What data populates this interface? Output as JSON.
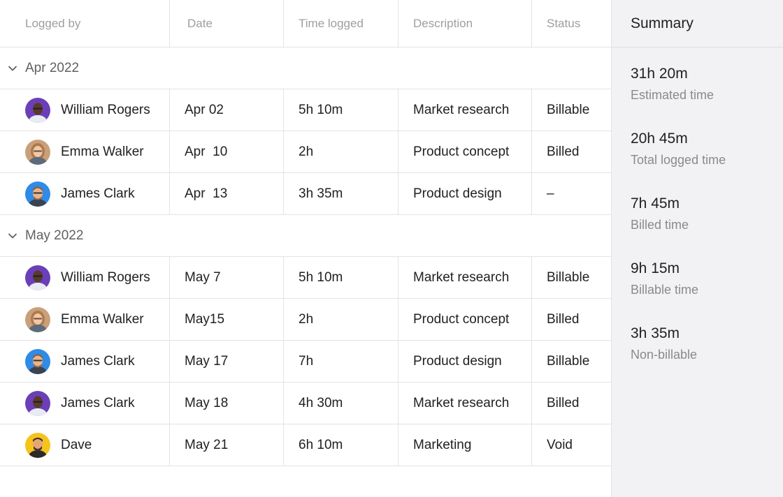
{
  "columns": {
    "logged_by": "Logged by",
    "date": "Date",
    "time_logged": "Time logged",
    "description": "Description",
    "status": "Status"
  },
  "groups": [
    {
      "label": "Apr 2022",
      "rows": [
        {
          "name": "William Rogers",
          "avatar": "purple-avatar",
          "date": "Apr 02",
          "time": "5h 10m",
          "description": "Market research",
          "status": "Billable"
        },
        {
          "name": "Emma Walker",
          "avatar": "beige-avatar",
          "date": "Apr  10",
          "time": "2h",
          "description": "Product concept",
          "status": "Billed"
        },
        {
          "name": "James Clark",
          "avatar": "blue-avatar",
          "date": "Apr  13",
          "time": "3h 35m",
          "description": "Product design",
          "status": "–"
        }
      ]
    },
    {
      "label": "May 2022",
      "rows": [
        {
          "name": "William Rogers",
          "avatar": "purple-avatar",
          "date": "May 7",
          "time": "5h 10m",
          "description": "Market research",
          "status": "Billable"
        },
        {
          "name": "Emma Walker",
          "avatar": "beige-avatar",
          "date": "May15",
          "time": "2h",
          "description": "Product concept",
          "status": "Billed"
        },
        {
          "name": "James Clark",
          "avatar": "blue-avatar",
          "date": "May 17",
          "time": "7h",
          "description": "Product design",
          "status": "Billable"
        },
        {
          "name": "James Clark",
          "avatar": "purple-avatar",
          "date": "May 18",
          "time": "4h 30m",
          "description": "Market research",
          "status": "Billed"
        },
        {
          "name": "Dave",
          "avatar": "yellow-avatar",
          "date": "May 21",
          "time": "6h 10m",
          "description": "Marketing",
          "status": "Void"
        }
      ]
    }
  ],
  "summary": {
    "title": "Summary",
    "stats": [
      {
        "value": "31h 20m",
        "label": "Estimated time"
      },
      {
        "value": "20h 45m",
        "label": "Total logged time"
      },
      {
        "value": "7h 45m",
        "label": "Billed time"
      },
      {
        "value": "9h 15m",
        "label": "Billable time"
      },
      {
        "value": "3h 35m",
        "label": "Non-billable"
      }
    ]
  },
  "colors": {
    "purple": "#6a3fb8",
    "beige": "#c9a07a",
    "blue": "#2f8be6",
    "yellow": "#f5c31c",
    "border": "#e3e3e3",
    "summary_bg": "#f2f2f4"
  }
}
